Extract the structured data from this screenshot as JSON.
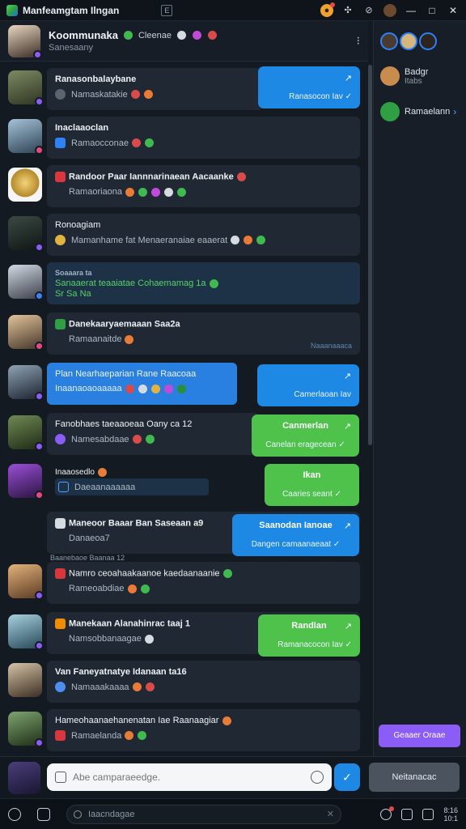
{
  "app": {
    "title": "Manfeamgtam Ilngan",
    "badge": "E"
  },
  "titlebar": {
    "minimize": "—",
    "maximize": "□",
    "close": "✕"
  },
  "header": {
    "name": "Koommunaka",
    "tag": "Cleenae",
    "subtitle": "Sanesaany",
    "more": "⁝"
  },
  "messages": [
    {
      "title": "Ranasonbalaybane",
      "sub": "Namaskatakie",
      "chip": "gray"
    },
    {
      "title": "Inaclaaoclan",
      "sub": "Ramaocconae",
      "chip": "blue"
    },
    {
      "title": "Randoor Paar Iannnarinaean Aacaanke",
      "sub": "Ramaoriaona",
      "chip": "red"
    },
    {
      "title": "Ronoagiam",
      "sub": "Mamanhame fat  Menaeranaiae eaaerat",
      "chip": "yellow"
    },
    {
      "title": "Soaaara ta",
      "sub": "Sanaaerat teaaiatae  Cohaemamag 1a",
      "sub2": "Sr Sa  Na",
      "chip": "none"
    },
    {
      "title": "Danekaaryaemaaan Saa2a",
      "sub": "Ramaanaitde",
      "chip": "green",
      "tiny": "Naaanaaaca"
    },
    {
      "title": "Plan Nearhaeparian Rane Raacoaa",
      "sub": "Inaanaoaoaaaaa",
      "chip": "none"
    },
    {
      "title": "Fanobhaes taeaaoeaa Oany ca 12",
      "sub": "Namesabdaae",
      "chip": "gray"
    },
    {
      "title": "Inaaosedlo",
      "sub": "Daeaanaaaaaa",
      "chip": "blue"
    },
    {
      "title": "Maneoor Baaar Ban Saseaan a9",
      "sub": "Danaeoa7",
      "chip": "gray"
    },
    {
      "title": "Namro ceoahaakaanoe kaedaanaanie",
      "sub": "Rameoabdiae",
      "chip": "red",
      "overline": "Baanebaoe Baanaa 12"
    },
    {
      "title": "Manekaan Alanahinrac taaj 1",
      "sub": "Namsobbanaagae",
      "chip": "orange"
    },
    {
      "title": "Van Faneyatnatye Idanaan ta16",
      "sub": "Namaaakaaaa",
      "chip": "blue"
    },
    {
      "title": "Hameohaanaehanenatan Iae Raanaagiar",
      "sub": "Ramaelanda",
      "chip": "red"
    }
  ],
  "side_cards": [
    {
      "top": "↗",
      "bottom": "Ranasocon Iav ✓",
      "color": "blue"
    },
    {
      "top": "↗",
      "bottom": "Camerlaoan Iav",
      "color": "blue"
    },
    {
      "top": "Canmerlan",
      "bottom": "Canelan eragecean ✓",
      "color": "green"
    },
    {
      "top": "Ikan",
      "bottom": "Caaries seant ✓",
      "color": "green"
    },
    {
      "top": "Saanodan Ianoae",
      "bottom": "Dangen camaanaeaat ✓",
      "color": "blue"
    },
    {
      "top": "Randlan",
      "bottom": "Ramanacocon Iav ✓",
      "color": "green"
    }
  ],
  "right_panel": {
    "item1_title": "Badgr",
    "item1_sub": "Itabs",
    "item2_label": "Ramaelann",
    "cta": "Geaaer Oraae"
  },
  "composer": {
    "placeholder": "Abe camparaeedge.",
    "send_icon": "✓",
    "right_button": "Neitanacac"
  },
  "taskbar": {
    "search_text": "Iaacndagae",
    "close": "✕",
    "time": "8:16",
    "date": "10:1"
  },
  "colors": {
    "accent_blue": "#1e88e5",
    "accent_green": "#4ec24b",
    "accent_purple": "#8b5cf6"
  }
}
